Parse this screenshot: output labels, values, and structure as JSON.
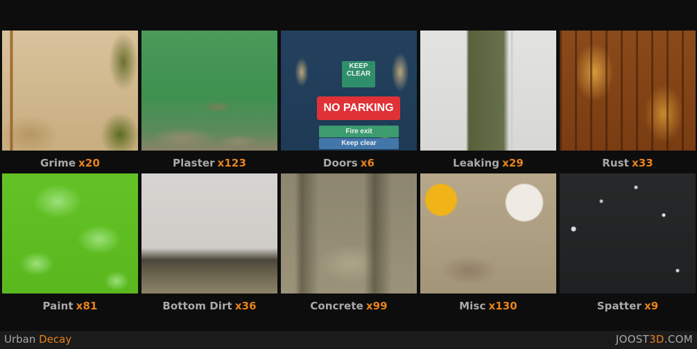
{
  "tiles": [
    {
      "name": "Grime",
      "count": "x20"
    },
    {
      "name": "Plaster",
      "count": "x123"
    },
    {
      "name": "Doors",
      "count": "x6"
    },
    {
      "name": "Leaking",
      "count": "x29"
    },
    {
      "name": "Rust",
      "count": "x33"
    },
    {
      "name": "Paint",
      "count": "x81"
    },
    {
      "name": "Bottom Dirt",
      "count": "x36"
    },
    {
      "name": "Concrete",
      "count": "x99"
    },
    {
      "name": "Misc",
      "count": "x130"
    },
    {
      "name": "Spatter",
      "count": "x9"
    }
  ],
  "doors_signs": {
    "keep_clear_small": "KEEP CLEAR",
    "no_parking": "NO PARKING",
    "fire_exit": "Fire exit",
    "keep_clear": "Keep clear"
  },
  "footer": {
    "brand_prefix": "Urban",
    "brand_accent": "Decay",
    "site_prefix": "JOOST",
    "site_accent": "3D",
    "site_suffix": ".COM"
  },
  "colors": {
    "background": "#0d0d0d",
    "label": "#a9a9a9",
    "accent": "#e8821d"
  }
}
